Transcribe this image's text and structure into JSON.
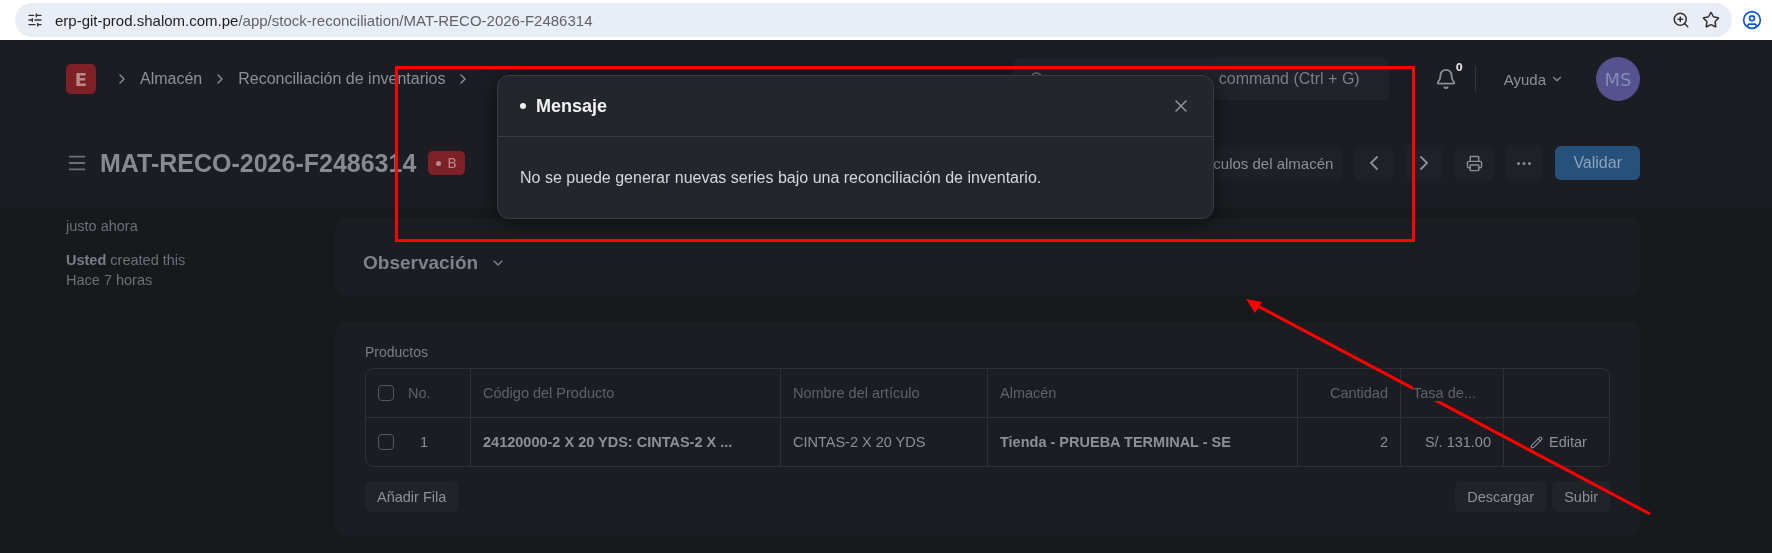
{
  "browser": {
    "url_host": "erp-git-prod.shalom.com.pe",
    "url_path": "/app/stock-reconciliation/MAT-RECO-2026-F2486314"
  },
  "navbar": {
    "logo": "E",
    "breadcrumbs": [
      "Almacén",
      "Reconciliación de inventarios"
    ],
    "search": {
      "placeholder": "command (Ctrl + G)"
    },
    "notifications": "0",
    "help": "Ayuda",
    "avatar": "MS"
  },
  "header": {
    "title": "MAT-RECO-2026-F2486314",
    "status": "B",
    "linked_button": "culos del almacén",
    "primary_button": "Validar"
  },
  "sidebar": {
    "timestamp": "justo ahora",
    "activity": "**Usted** created this",
    "activity_time": "Hace 7 horas"
  },
  "section": {
    "title": "Observación",
    "expanded": false
  },
  "table": {
    "label": "Productos",
    "select_all": {
      "checked": false
    },
    "columns": [
      "No.",
      "Código del Producto",
      "Nombre del artículo",
      "Almacén",
      "Cantidad",
      "Tasa de..."
    ],
    "rows": [
      {
        "checked": false,
        "cells": [
          "1",
          "24120000-2 X 20 YDS: CINTAS-2 X ...",
          "CINTAS-2 X 20 YDS",
          "Tienda - PRUEBA TERMINAL - SE",
          "2",
          "S/. 131.00"
        ],
        "edit": "Editar"
      }
    ],
    "add_row": "Añadir Fila",
    "download": "Descargar",
    "upload": "Subir"
  },
  "dialog": {
    "title": "Mensaje",
    "message": "No se puede generar nuevas series bajo una reconciliación de inventario."
  }
}
